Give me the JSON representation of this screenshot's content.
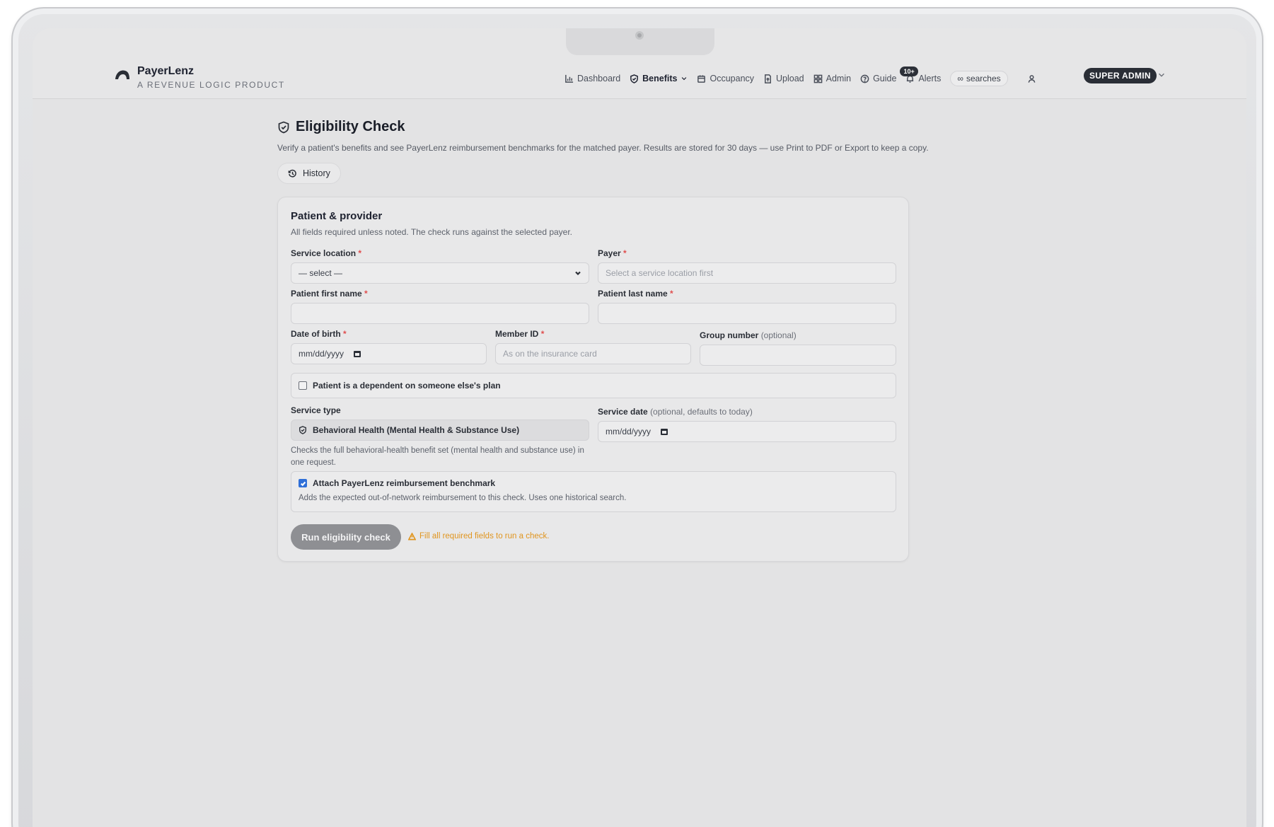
{
  "brand": {
    "name": "PayerLenz",
    "tagline": "A REVENUE LOGIC PRODUCT"
  },
  "nav": {
    "dashboard": "Dashboard",
    "benefits": "Benefits",
    "occupancy": "Occupancy",
    "upload": "Upload",
    "admin": "Admin",
    "guide": "Guide",
    "alerts_badge": "10+",
    "alerts": "Alerts",
    "searches_symbol": "∞",
    "searches": "searches",
    "role": "SUPER ADMIN"
  },
  "page": {
    "title": "Eligibility Check",
    "description": "Verify a patient's benefits and see PayerLenz reimbursement benchmarks for the matched payer. Results are stored for 30 days — use Print to PDF or Export to keep a copy.",
    "history_label": "History"
  },
  "form": {
    "title": "Patient & provider",
    "subtitle": "All fields required unless noted. The check runs against the selected payer.",
    "required_mark": "*",
    "service_location": {
      "label": "Service location",
      "value": "— select —"
    },
    "payer": {
      "label": "Payer",
      "placeholder": "Select a service location first"
    },
    "first_name": {
      "label": "Patient first name",
      "value": ""
    },
    "last_name": {
      "label": "Patient last name",
      "value": ""
    },
    "dob": {
      "label": "Date of birth",
      "placeholder": "mm/dd/yyyy"
    },
    "member_id": {
      "label": "Member ID",
      "placeholder": "As on the insurance card"
    },
    "group_number": {
      "label": "Group number",
      "optional": "(optional)",
      "value": ""
    },
    "dependent": {
      "label": "Patient is a dependent on someone else's plan",
      "checked": false
    },
    "service_type": {
      "label": "Service type",
      "value": "Behavioral Health (Mental Health & Substance Use)",
      "helper": "Checks the full behavioral-health benefit set (mental health and substance use) in one request."
    },
    "service_date": {
      "label": "Service date",
      "optional": "(optional, defaults to today)",
      "placeholder": "mm/dd/yyyy"
    },
    "benchmark": {
      "label": "Attach PayerLenz reimbursement benchmark",
      "description": "Adds the expected out-of-network reimbursement to this check. Uses one historical search.",
      "checked": true
    },
    "run_button": "Run eligibility check",
    "warning": "Fill all required fields to run a check."
  },
  "colors": {
    "warning": "#e0951f",
    "checkbox_checked": "#2f6fd8",
    "required": "#e04e4e",
    "button_disabled": "#8e8f93"
  }
}
